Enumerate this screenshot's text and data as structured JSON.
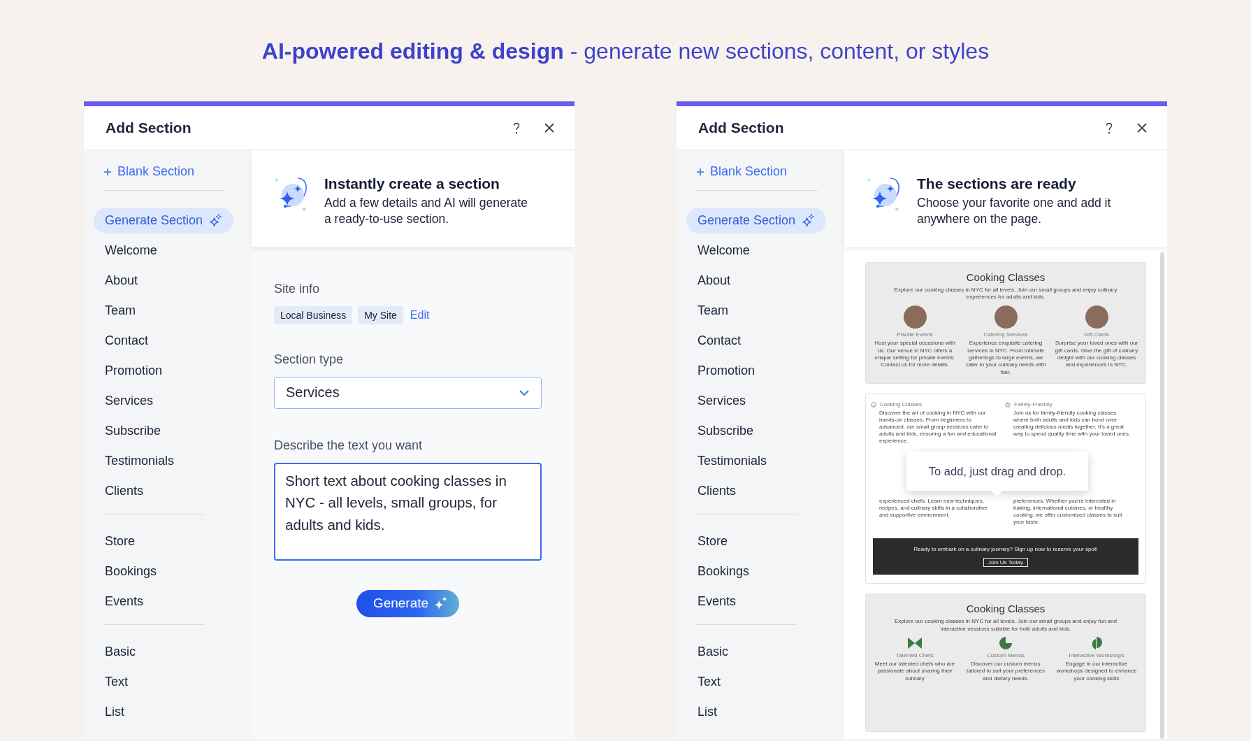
{
  "headline": {
    "text": "**AI-powered editing & design** - generate new sections, content, or styles"
  },
  "panels": [
    {
      "title": "Add Section",
      "blank_section": "Blank Section",
      "sidebar_groups": [
        {
          "items": [
            {
              "label": "Generate Section",
              "selected": true,
              "kind": "ai"
            },
            {
              "label": "Welcome",
              "selected": false,
              "kind": "plain"
            },
            {
              "label": "About",
              "selected": false,
              "kind": "plain"
            },
            {
              "label": "Team",
              "selected": false,
              "kind": "plain"
            },
            {
              "label": "Contact",
              "selected": false,
              "kind": "plain"
            },
            {
              "label": "Promotion",
              "selected": false,
              "kind": "plain"
            },
            {
              "label": "Services",
              "selected": false,
              "kind": "plain"
            },
            {
              "label": "Subscribe",
              "selected": false,
              "kind": "plain"
            },
            {
              "label": "Testimonials",
              "selected": false,
              "kind": "plain"
            },
            {
              "label": "Clients",
              "selected": false,
              "kind": "plain"
            }
          ]
        },
        {
          "items": [
            {
              "label": "Store",
              "selected": false,
              "kind": "plain"
            },
            {
              "label": "Bookings",
              "selected": false,
              "kind": "plain"
            },
            {
              "label": "Events",
              "selected": false,
              "kind": "plain"
            }
          ]
        },
        {
          "items": [
            {
              "label": "Basic",
              "selected": false,
              "kind": "plain"
            },
            {
              "label": "Text",
              "selected": false,
              "kind": "plain"
            },
            {
              "label": "List",
              "selected": false,
              "kind": "plain"
            }
          ]
        }
      ],
      "intro": {
        "title": "Instantly create a section",
        "text": "Add a few details and AI will generate a ready-to-use section."
      },
      "content": {
        "kind": "form",
        "site_info": {
          "label": "Site info",
          "tags": [
            "Local Business",
            "My Site"
          ],
          "edit_link": "Edit"
        },
        "section_type": {
          "label": "Section type",
          "value": "Services"
        },
        "description": {
          "label": "Describe the text you want",
          "value": "Short text about cooking classes in NYC - all levels, small groups, for adults and kids."
        },
        "generate_button": "Generate"
      }
    },
    {
      "title": "Add Section",
      "blank_section": "Blank Section",
      "sidebar_groups": [
        {
          "items": [
            {
              "label": "Generate Section",
              "selected": true,
              "kind": "ai"
            },
            {
              "label": "Welcome",
              "selected": false,
              "kind": "plain"
            },
            {
              "label": "About",
              "selected": false,
              "kind": "plain"
            },
            {
              "label": "Team",
              "selected": false,
              "kind": "plain"
            },
            {
              "label": "Contact",
              "selected": false,
              "kind": "plain"
            },
            {
              "label": "Promotion",
              "selected": false,
              "kind": "plain"
            },
            {
              "label": "Services",
              "selected": false,
              "kind": "plain"
            },
            {
              "label": "Subscribe",
              "selected": false,
              "kind": "plain"
            },
            {
              "label": "Testimonials",
              "selected": false,
              "kind": "plain"
            },
            {
              "label": "Clients",
              "selected": false,
              "kind": "plain"
            }
          ]
        },
        {
          "items": [
            {
              "label": "Store",
              "selected": false,
              "kind": "plain"
            },
            {
              "label": "Bookings",
              "selected": false,
              "kind": "plain"
            },
            {
              "label": "Events",
              "selected": false,
              "kind": "plain"
            }
          ]
        },
        {
          "items": [
            {
              "label": "Basic",
              "selected": false,
              "kind": "plain"
            },
            {
              "label": "Text",
              "selected": false,
              "kind": "plain"
            },
            {
              "label": "List",
              "selected": false,
              "kind": "plain"
            }
          ]
        }
      ],
      "intro": {
        "title": "The sections are ready",
        "text": "Choose your favorite one and add it anywhere on the page."
      },
      "content": {
        "kind": "results",
        "cards": [
          {
            "kind": "photos",
            "title": "Cooking Classes",
            "intro": "Explore our cooking classes in NYC for all levels. Join our small groups and enjoy culinary experiences for adults and kids.",
            "items": [
              {
                "name": "Private Events",
                "text": "Host your special occasions with us. Our venue in NYC offers a unique setting for private events. Contact us for more details."
              },
              {
                "name": "Catering Services",
                "text": "Experience exquisite catering services in NYC. From intimate gatherings to large events, we cater to your culinary needs with flair."
              },
              {
                "name": "Gift Cards",
                "text": "Surprise your loved ones with our gift cards. Give the gift of culinary delight with our cooking classes and experiences in NYC."
              }
            ]
          },
          {
            "kind": "columns",
            "tooltip": "To add, just drag and drop.",
            "columns": [
              {
                "kind": "smiley",
                "name": "Cooking Classes",
                "text": "Discover the art of cooking in NYC with our hands-on classes. From beginners to advanced, our small group sessions cater to adults and kids, ensuring a fun and educational experience.",
                "text_2": "experienced chefs. Learn new techniques, recipes, and culinary skills in a collaborative and supportive environment."
              },
              {
                "kind": "star",
                "name": "Family-Friendly",
                "text": "Join us for family-friendly cooking classes where both adults and kids can bond over creating delicious meals together. It's a great way to spend quality time with your loved ones.",
                "text_2": "preferences. Whether you're interested in baking, international cuisines, or healthy cooking, we offer customized classes to suit your taste."
              }
            ],
            "banner": {
              "text": "Ready to embark on a culinary journey? Sign up now to reserve your spot!",
              "button": "Join Us Today"
            }
          },
          {
            "kind": "shapes",
            "title": "Cooking Classes",
            "intro": "Explore our cooking classes in NYC for all levels. Join our small groups and enjoy fun and interactive sessions suitable for both adults and kids.",
            "items": [
              {
                "kind": "bowtie",
                "name": "Talented Chefs",
                "text": "Meet our talented chefs who are passionate about sharing their culinary"
              },
              {
                "kind": "pie",
                "name": "Custom Menus",
                "text": "Discover our custom menus tailored to suit your preferences and dietary needs."
              },
              {
                "kind": "leaf",
                "name": "Interactive Workshops",
                "text": "Engage in our interactive workshops designed to enhance your cooking skills"
              }
            ]
          }
        ]
      }
    }
  ]
}
